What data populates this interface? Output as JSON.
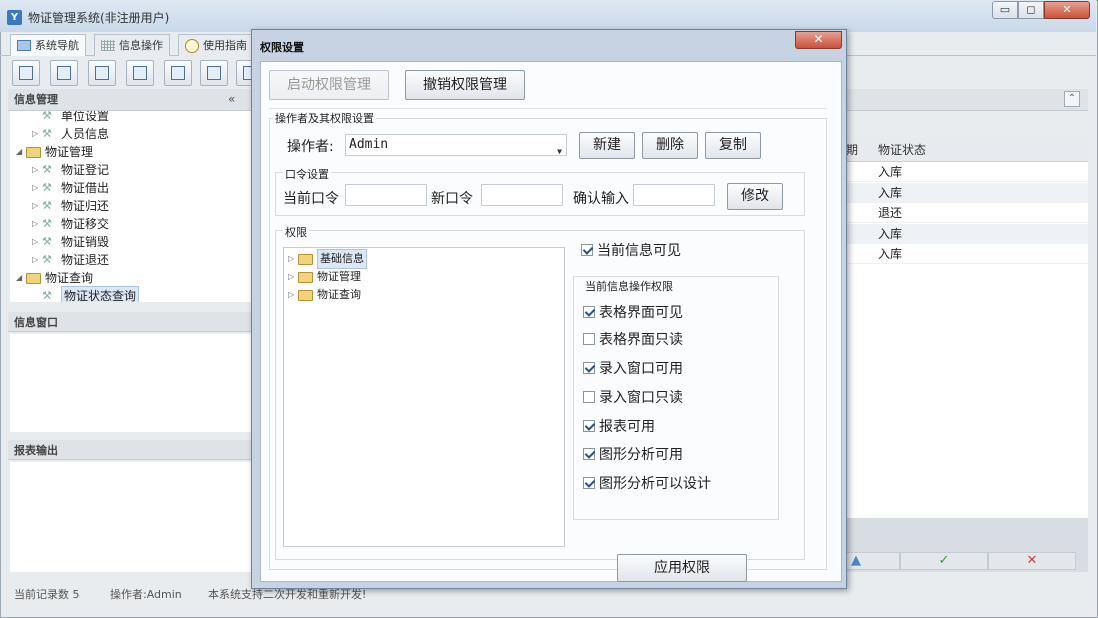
{
  "app": {
    "title": "物证管理系统(非注册用户)",
    "icon_letter": "Y",
    "window_controls": {
      "minimize": "▭",
      "maximize": "◻",
      "close": "✕"
    }
  },
  "tabs": [
    {
      "label": "系统导航",
      "icon": "monitor-icon"
    },
    {
      "label": "信息操作",
      "icon": "grid-icon"
    },
    {
      "label": "使用指南",
      "icon": "clock-icon"
    }
  ],
  "left_panel": {
    "header": "信息管理",
    "collapse_glyph": "«",
    "tree": [
      {
        "level": 2,
        "kind": "leaf",
        "label": "单位设置",
        "expander": ""
      },
      {
        "level": 2,
        "kind": "leaf",
        "label": "人员信息",
        "expander": "▷"
      },
      {
        "level": 1,
        "kind": "folder",
        "label": "物证管理",
        "expander": "◢"
      },
      {
        "level": 2,
        "kind": "leaf",
        "label": "物证登记",
        "expander": "▷"
      },
      {
        "level": 2,
        "kind": "leaf",
        "label": "物证借出",
        "expander": "▷"
      },
      {
        "level": 2,
        "kind": "leaf",
        "label": "物证归还",
        "expander": "▷"
      },
      {
        "level": 2,
        "kind": "leaf",
        "label": "物证移交",
        "expander": "▷"
      },
      {
        "level": 2,
        "kind": "leaf",
        "label": "物证销毁",
        "expander": "▷"
      },
      {
        "level": 2,
        "kind": "leaf",
        "label": "物证退还",
        "expander": "▷"
      },
      {
        "level": 1,
        "kind": "folder",
        "label": "物证查询",
        "expander": "◢"
      },
      {
        "level": 2,
        "kind": "leaf",
        "label": "物证状态查询",
        "expander": "",
        "selected": true
      }
    ],
    "info_window_header": "信息窗口",
    "report_header": "报表输出"
  },
  "right_grid": {
    "collapse_glyph": "⌃",
    "columns": [
      "期",
      "物证状态"
    ],
    "rows": [
      "入库",
      "入库",
      "退还",
      "入库",
      "入库"
    ],
    "footer_buttons": [
      "▲",
      "✓",
      "✕"
    ]
  },
  "statusbar": {
    "records": "当前记录数 5",
    "operator": "操作者:Admin",
    "notice": "本系统支持二次开发和重新开发!"
  },
  "dialog": {
    "title": "权限设置",
    "close_glyph": "✕",
    "top_buttons": {
      "enable": "启动权限管理",
      "revoke": "撤销权限管理"
    },
    "operator_group": {
      "label": "操作者及其权限设置",
      "operator_label": "操作者:",
      "operator_value": "Admin",
      "dropdown_glyph": "▼",
      "buttons": {
        "new": "新建",
        "delete": "删除",
        "copy": "复制"
      }
    },
    "password_group": {
      "label": "口令设置",
      "current_label": "当前口令",
      "new_label": "新口令",
      "confirm_label": "确认输入",
      "current_value": "",
      "new_value": "",
      "confirm_value": "",
      "modify_button": "修改"
    },
    "permission_group": {
      "label": "权限",
      "tree": [
        {
          "label": "基础信息",
          "selected": true
        },
        {
          "label": "物证管理",
          "selected": false
        },
        {
          "label": "物证查询",
          "selected": false
        }
      ],
      "tree_expander": "▷",
      "current_visible": {
        "label": "当前信息可见",
        "checked": true
      },
      "ops_group_label": "当前信息操作权限",
      "ops": [
        {
          "label": "表格界面可见",
          "checked": true
        },
        {
          "label": "表格界面只读",
          "checked": false
        },
        {
          "label": "录入窗口可用",
          "checked": true
        },
        {
          "label": "录入窗口只读",
          "checked": false
        },
        {
          "label": "报表可用",
          "checked": true
        },
        {
          "label": "图形分析可用",
          "checked": true
        },
        {
          "label": "图形分析可以设计",
          "checked": true
        }
      ],
      "apply_button": "应用权限"
    }
  }
}
